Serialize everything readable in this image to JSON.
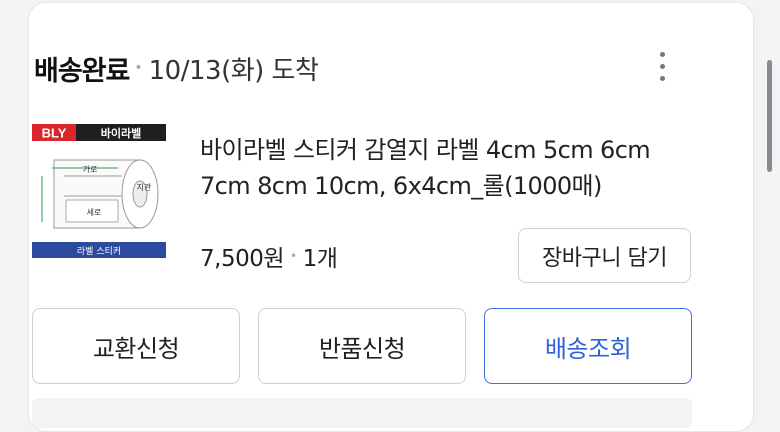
{
  "order": {
    "status": "배송완료",
    "date": "10/13(화) 도착"
  },
  "product": {
    "name": "바이라벨 스티커 감열지 라벨 4cm 5cm 6cm 7cm 8cm 10cm, 6x4cm_롤(1000매)",
    "price": "7,500원",
    "quantity": "1개",
    "thumbnail": {
      "brand": "BLY",
      "title": "바이라벨",
      "width_label": "가로",
      "height_label": "세로",
      "diameter_label": "지관",
      "footer": "라벨 스티커"
    }
  },
  "buttons": {
    "cart": "장바구니 담기",
    "exchange": "교환신청",
    "return": "반품신청",
    "tracking": "배송조회"
  },
  "icons": {
    "more": "more-vertical-icon"
  },
  "colors": {
    "accent": "#2f62da",
    "brand_red": "#d9262a",
    "label_blue": "#2b4aa0"
  }
}
